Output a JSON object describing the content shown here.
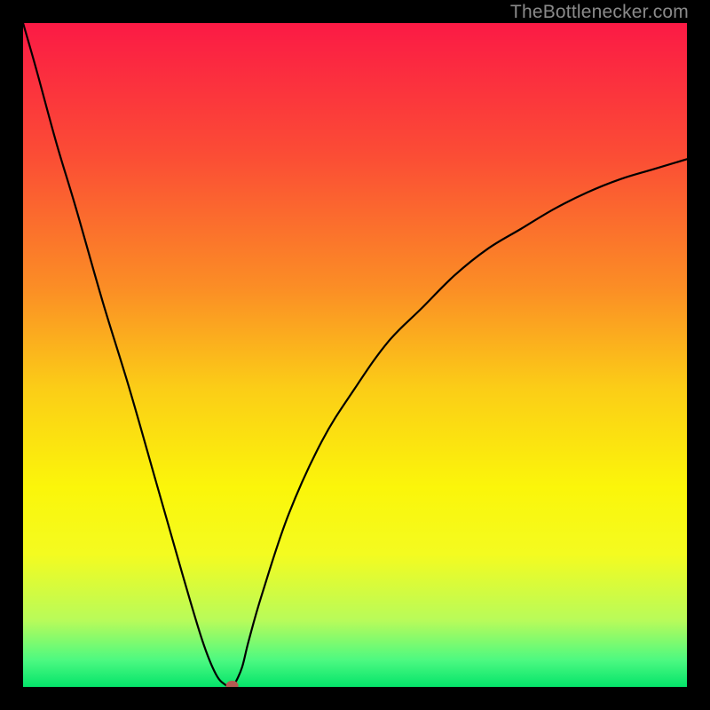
{
  "source_label": "TheBottlenecker.com",
  "chart_data": {
    "type": "line",
    "title": "",
    "xlabel": "",
    "ylabel": "",
    "xlim": [
      0,
      100
    ],
    "ylim": [
      0,
      100
    ],
    "gradient_stops": [
      {
        "offset": 0,
        "color": "#fb1a45"
      },
      {
        "offset": 20,
        "color": "#fb4d35"
      },
      {
        "offset": 40,
        "color": "#fb8e25"
      },
      {
        "offset": 55,
        "color": "#fbcd17"
      },
      {
        "offset": 70,
        "color": "#fbf60a"
      },
      {
        "offset": 80,
        "color": "#f4fb20"
      },
      {
        "offset": 90,
        "color": "#b8fb5a"
      },
      {
        "offset": 96,
        "color": "#4cf981"
      },
      {
        "offset": 100,
        "color": "#04e46a"
      }
    ],
    "curve": {
      "comment": "Bottleneck percentage vs. a swept parameter. Zero at the minimum, rising toward both edges.",
      "x": [
        0,
        2,
        5,
        8,
        12,
        16,
        20,
        24,
        27,
        29,
        30.5,
        31.5,
        32,
        33,
        34,
        36,
        40,
        45,
        50,
        55,
        60,
        65,
        70,
        75,
        80,
        85,
        90,
        95,
        100
      ],
      "y": [
        100,
        93,
        82,
        72,
        58,
        45,
        31,
        17,
        7,
        2,
        0.3,
        0.2,
        0.7,
        3,
        7,
        14,
        26,
        37,
        45,
        52,
        57,
        62,
        66,
        69,
        72,
        74.5,
        76.5,
        78,
        79.5
      ]
    },
    "min_marker": {
      "x": 31.5,
      "y": 0.2,
      "color": "#b55a52"
    }
  }
}
